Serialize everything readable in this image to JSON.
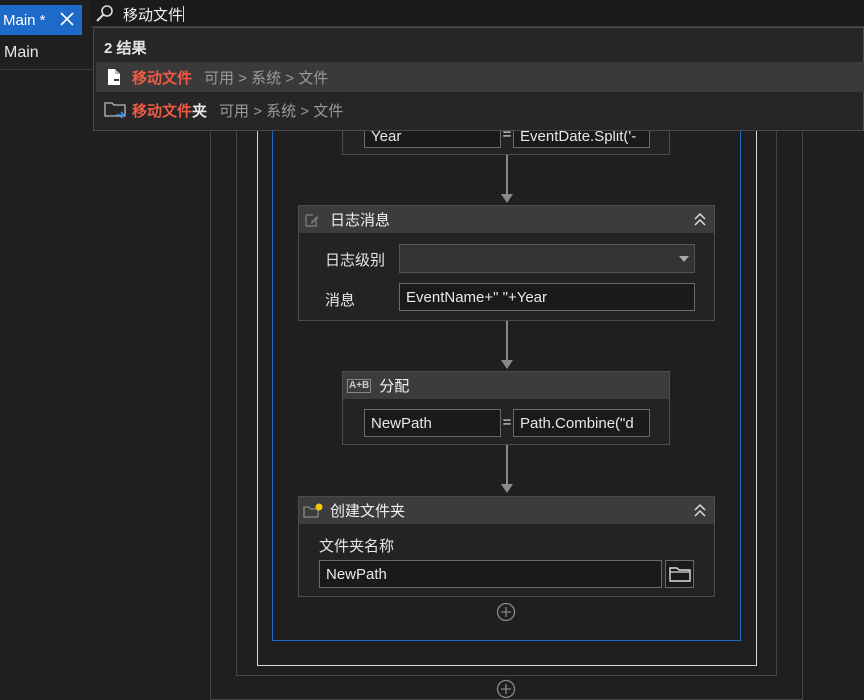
{
  "tabs": {
    "active_label": "Main *",
    "breadcrumb": "Main"
  },
  "search": {
    "query": "移动文件",
    "result_count": "2 结果",
    "results": [
      {
        "highlight": "移动文件",
        "rest": "",
        "path": "可用 > 系统 > 文件"
      },
      {
        "highlight": "移动文件",
        "rest": "夹",
        "path": "可用 > 系统 > 文件"
      }
    ]
  },
  "workflow": {
    "assign_top": {
      "left": "Year",
      "right": "EventDate.Split('-"
    },
    "log_message": {
      "title": "日志消息",
      "level_label": "日志级别",
      "level_value": "",
      "message_label": "消息",
      "message_value": "EventName+\" \"+Year"
    },
    "assign": {
      "title": "分配",
      "icon_text": "A+B",
      "left": "NewPath",
      "right": "Path.Combine(\"d"
    },
    "create_folder": {
      "title": "创建文件夹",
      "folder_label": "文件夹名称",
      "folder_value": "NewPath"
    }
  }
}
